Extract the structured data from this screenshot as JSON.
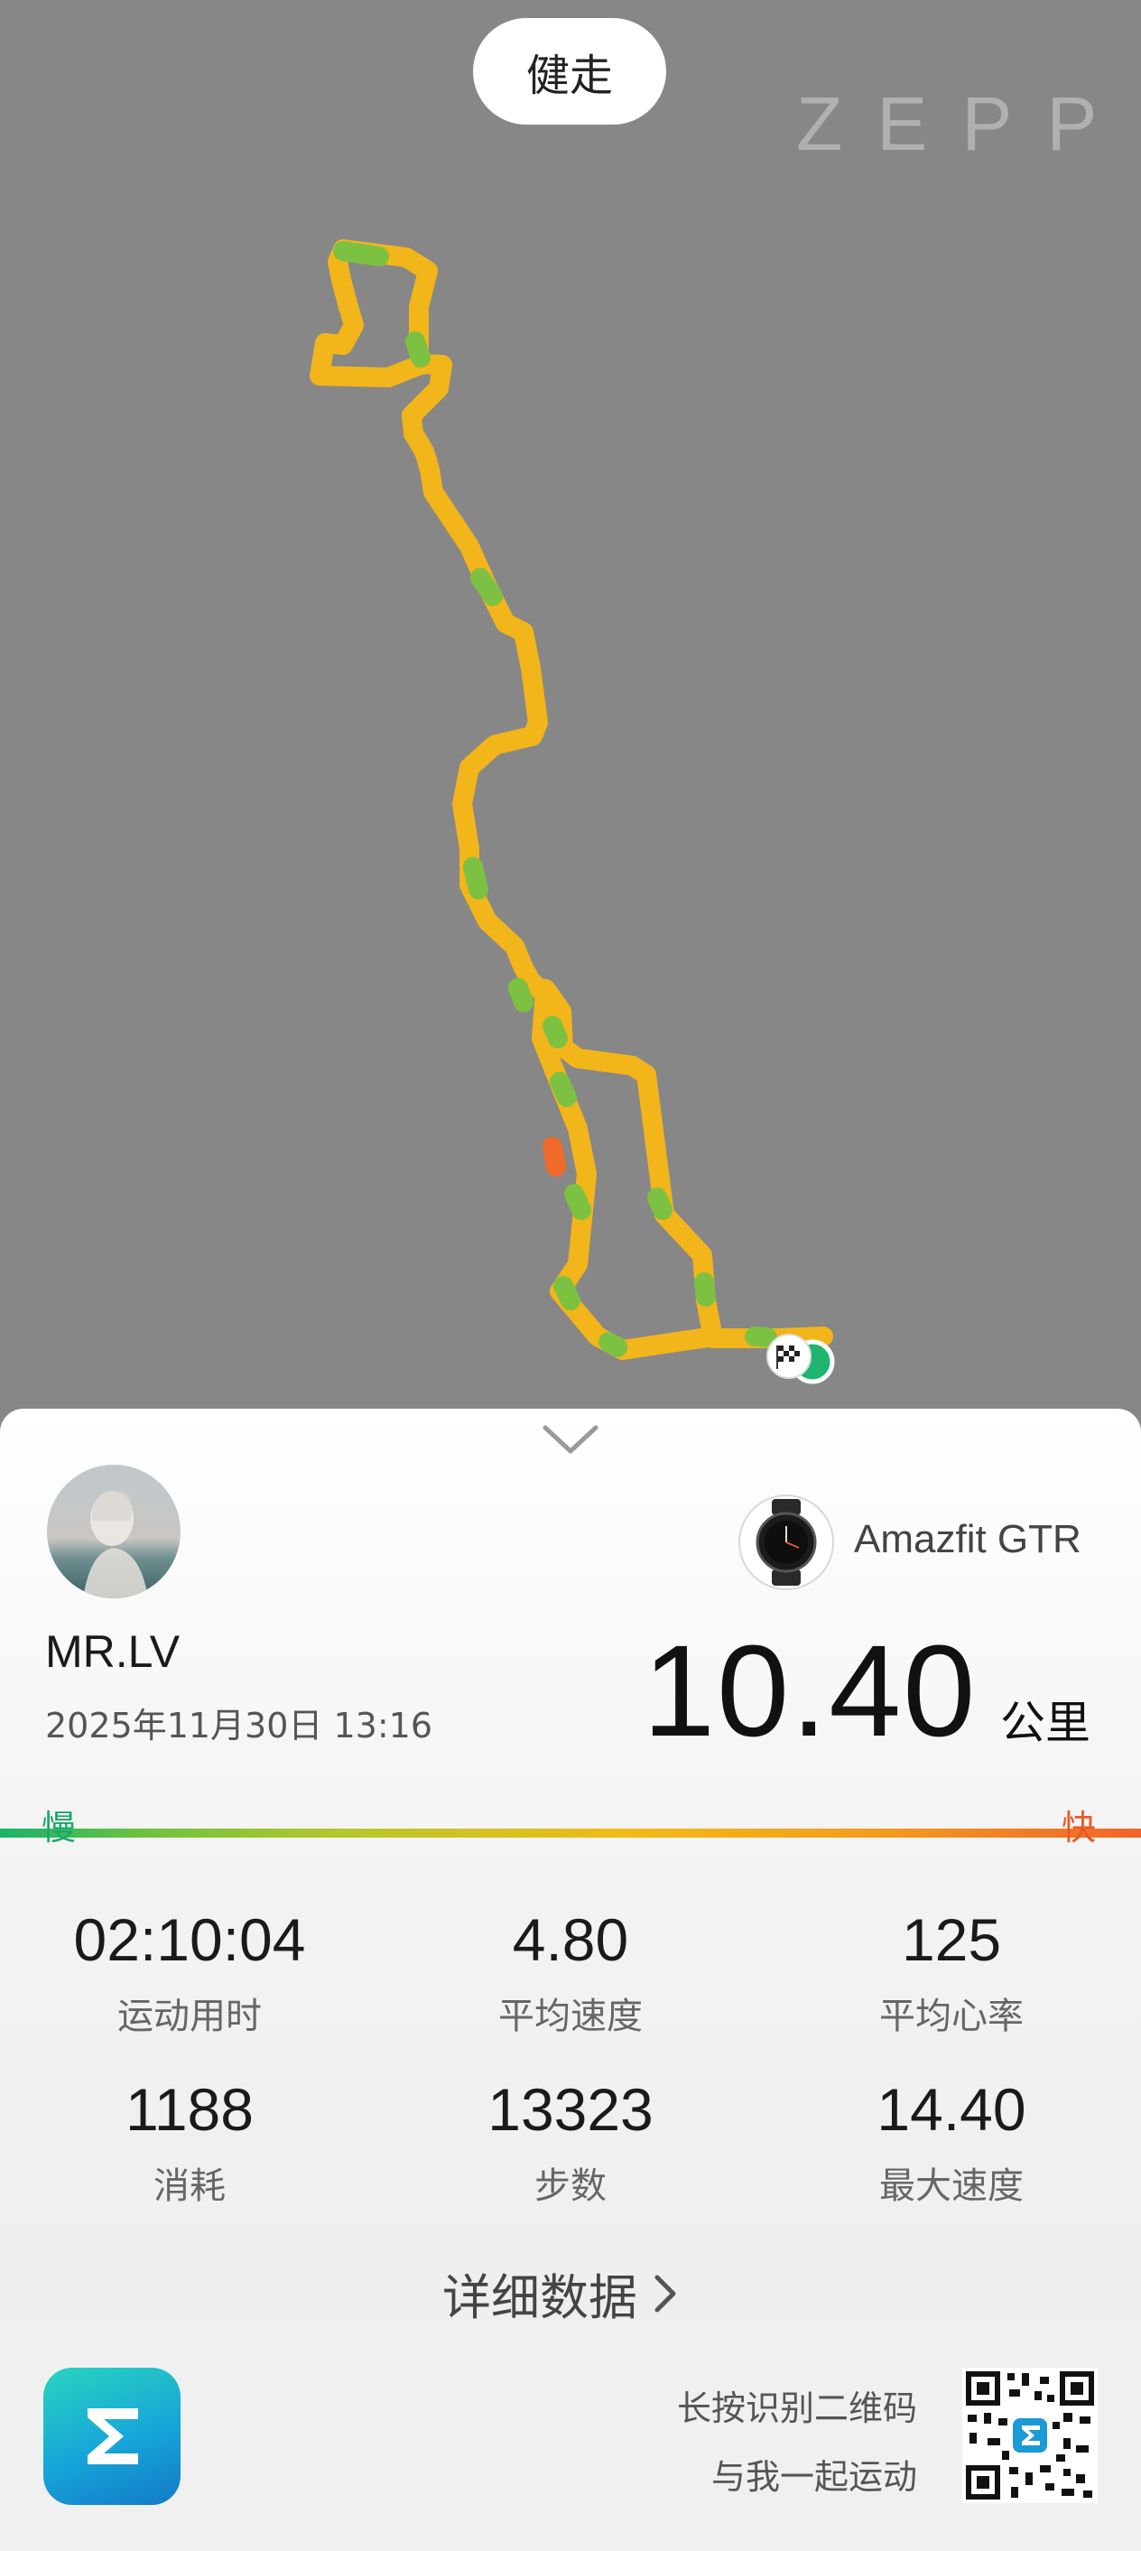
{
  "map": {
    "activity_type": "健走",
    "brand": "ZEPP"
  },
  "profile": {
    "name": "MR.LV",
    "date": "2025年11月30日 13:16"
  },
  "device": {
    "name": "Amazfit GTR"
  },
  "summary": {
    "distance": "10.40",
    "distance_unit": "公里"
  },
  "speed_legend": {
    "slow": "慢",
    "fast": "快",
    "colors": [
      "#19b36b",
      "#b6c72b",
      "#f1bb18",
      "#f0642a"
    ]
  },
  "stats": [
    {
      "value": "02:10:04",
      "label": "运动用时"
    },
    {
      "value": "4.80",
      "label": "平均速度"
    },
    {
      "value": "125",
      "label": "平均心率"
    },
    {
      "value": "1188",
      "label": "消耗"
    },
    {
      "value": "13323",
      "label": "步数"
    },
    {
      "value": "14.40",
      "label": "最大速度"
    }
  ],
  "details_link": "详细数据",
  "footer": {
    "qr_hint_line1": "长按识别二维码",
    "qr_hint_line2": "与我一起运动"
  }
}
